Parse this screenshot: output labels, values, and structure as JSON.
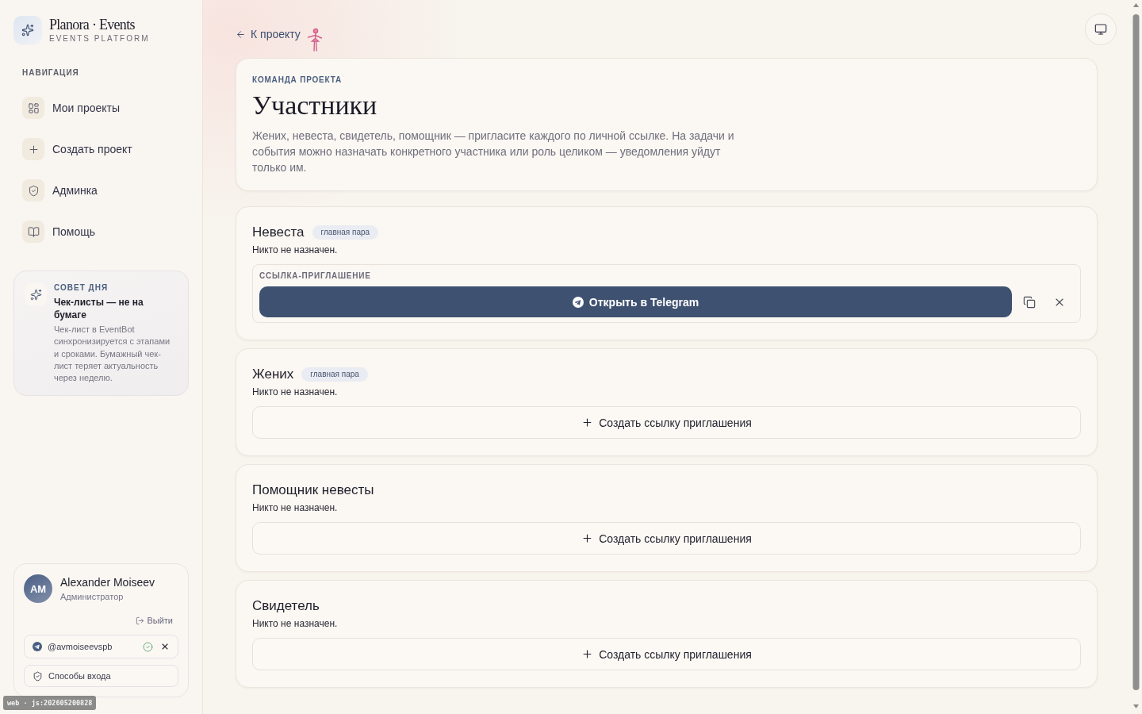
{
  "sidebar": {
    "brand": {
      "name": "Planora · Events",
      "tagline": "EVENTS PLATFORM"
    },
    "nav_heading": "НАВИГАЦИЯ",
    "nav_items": [
      {
        "label": "Мои проекты",
        "selected": false
      },
      {
        "label": "Создать проект",
        "selected": false
      },
      {
        "label": "Админка",
        "selected": false
      },
      {
        "label": "Помощь",
        "selected": false
      }
    ],
    "tip": {
      "heading": "СОВЕТ ДНЯ",
      "title": "Чек-листы — не на бумаге",
      "body": "Чек-лист в EventBot синхронизируется с этапами и сроками. Бумажный чек-лист теряет актуальность через неделю."
    },
    "user": {
      "initials": "AM",
      "name": "Alexander Moiseev",
      "role": "Администратор",
      "logout": "Выйти",
      "telegram": {
        "handle": "@avmoiseevspb",
        "verified": true
      },
      "login_methods": "Способы входа"
    }
  },
  "build_badge": "web · js:202605200828",
  "back_link": "К проекту",
  "header": {
    "eyebrow": "КОМАНДА ПРОЕКТА",
    "title": "Участники",
    "description": "Жених, невеста, свидетель, помощник — пригласите каждого по личной ссылке. На задачи и события можно назначать конкретного участника или роль целиком — уведомления уйдут только им."
  },
  "roles": [
    {
      "kind": "invite_link",
      "name": "Невеста",
      "badge": "главная пара",
      "status": "Никто не назначен.",
      "invite_label": "ССЫЛКА-ПРИГЛАШЕНИЕ",
      "open_button": "Открыть в Telegram"
    },
    {
      "kind": "no_link",
      "name": "Жених",
      "badge": "главная пара",
      "status": "Никто не назначен.",
      "create_button": "Создать ссылку приглашения"
    },
    {
      "kind": "no_link",
      "name": "Помощник невесты",
      "status": "Никто не назначен.",
      "create_button": "Создать ссылку приглашения"
    },
    {
      "kind": "no_link",
      "name": "Свидетель",
      "status": "Никто не назначен.",
      "create_button": "Создать ссылку приглашения"
    }
  ]
}
